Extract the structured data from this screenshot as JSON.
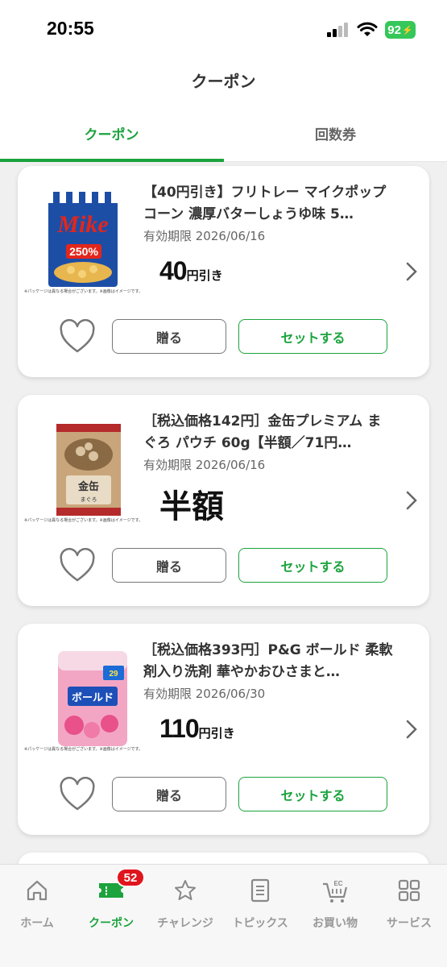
{
  "status": {
    "time": "20:55",
    "battery": "92"
  },
  "header": {
    "title": "クーポン"
  },
  "tabs": [
    {
      "label": "クーポン",
      "active": true
    },
    {
      "label": "回数券",
      "active": false
    }
  ],
  "coupons": [
    {
      "title": "【40円引き】フリトレー マイクポップコーン 濃厚バターしょうゆ味 5…",
      "expiry": "有効期限 2026/06/16",
      "discount_value": "40",
      "discount_unit": "円引き",
      "image_note": "※パッケージは異なる場合がございます。※画像はイメージです。",
      "image_label": "Mike 250%",
      "gift_label": "贈る",
      "set_label": "セットする"
    },
    {
      "title": "［税込価格142円］金缶プレミアム まぐろ パウチ 60g【半額／71円…",
      "expiry": "有効期限 2026/06/16",
      "discount_value": "半額",
      "discount_unit": "",
      "image_note": "※パッケージは異なる場合がございます。※画像はイメージです。",
      "image_label": "金缶 プレミアム まぐろ",
      "gift_label": "贈る",
      "set_label": "セットする"
    },
    {
      "title": "［税込価格393円］P&G ボールド 柔軟剤入り洗剤 華やかおひさまと…",
      "expiry": "有効期限 2026/06/30",
      "discount_value": "110",
      "discount_unit": "円引き",
      "image_note": "※パッケージは異なる場合がございます。※画像はイメージです。",
      "image_label": "ボールド",
      "gift_label": "贈る",
      "set_label": "セットする"
    }
  ],
  "nav": {
    "items": [
      {
        "label": "ホーム",
        "icon": "home-icon"
      },
      {
        "label": "クーポン",
        "icon": "coupon-icon",
        "badge": "52"
      },
      {
        "label": "チャレンジ",
        "icon": "star-icon"
      },
      {
        "label": "トピックス",
        "icon": "document-icon"
      },
      {
        "label": "お買い物",
        "icon": "ec-cart-icon"
      },
      {
        "label": "サービス",
        "icon": "grid-icon"
      }
    ]
  },
  "colors": {
    "accent": "#1ba33d",
    "badge": "#e0141d",
    "battery": "#35c759"
  }
}
